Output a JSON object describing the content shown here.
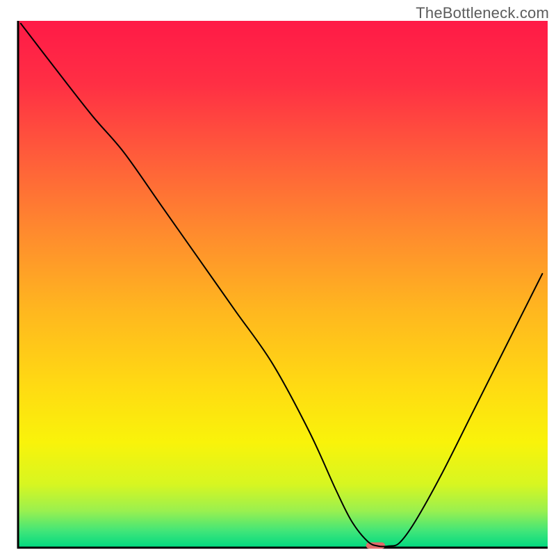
{
  "watermark": "TheBottleneck.com",
  "chart_data": {
    "type": "line",
    "title": "",
    "xlabel": "",
    "ylabel": "",
    "xlim": [
      0,
      100
    ],
    "ylim": [
      0,
      100
    ],
    "grid": false,
    "legend": false,
    "series": [
      {
        "name": "bottleneck-curve",
        "x": [
          0.5,
          7,
          14,
          20,
          27,
          34,
          41,
          48,
          55,
          60,
          63,
          66,
          68,
          70,
          72,
          75,
          80,
          86,
          93,
          99
        ],
        "y": [
          99.5,
          91,
          82,
          75,
          65,
          55,
          45,
          35,
          22,
          11,
          5,
          1.2,
          0.3,
          0.3,
          0.9,
          5,
          14,
          26,
          40,
          52
        ],
        "stroke": "#000000",
        "stroke_width": 2
      }
    ],
    "background_gradient": {
      "type": "vertical",
      "stops": [
        {
          "offset": 0.0,
          "color": "#ff1a47"
        },
        {
          "offset": 0.12,
          "color": "#ff2f44"
        },
        {
          "offset": 0.25,
          "color": "#ff5a3b"
        },
        {
          "offset": 0.4,
          "color": "#ff8a2e"
        },
        {
          "offset": 0.55,
          "color": "#ffb71f"
        },
        {
          "offset": 0.7,
          "color": "#ffdc12"
        },
        {
          "offset": 0.8,
          "color": "#f9f30a"
        },
        {
          "offset": 0.88,
          "color": "#d7f621"
        },
        {
          "offset": 0.93,
          "color": "#9af04f"
        },
        {
          "offset": 0.97,
          "color": "#3de57a"
        },
        {
          "offset": 1.0,
          "color": "#00d980"
        }
      ]
    },
    "marker": {
      "name": "target-marker",
      "x": 67.5,
      "y": 0.4,
      "width": 3.6,
      "height": 1.2,
      "color": "#e06a6a",
      "shape": "rounded-rect"
    },
    "axes": {
      "stroke": "#000000",
      "stroke_width": 3
    }
  }
}
